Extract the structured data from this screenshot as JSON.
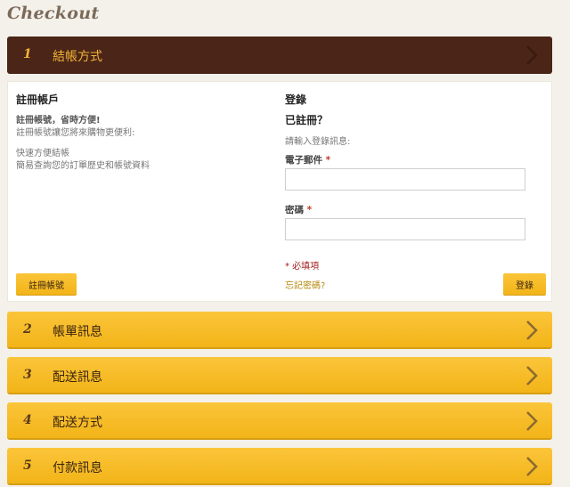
{
  "page": {
    "title": "Checkout"
  },
  "steps": [
    {
      "num": "1",
      "label": "結帳方式"
    },
    {
      "num": "2",
      "label": "帳單訊息"
    },
    {
      "num": "3",
      "label": "配送訊息"
    },
    {
      "num": "4",
      "label": "配送方式"
    },
    {
      "num": "5",
      "label": "付款訊息"
    }
  ],
  "register": {
    "heading": "註冊帳戶",
    "tagline": "註冊帳號，省時方便!",
    "desc": "註冊帳號讓您將來購物更便利:",
    "benefits": [
      "快速方便結帳",
      "簡易查詢您的訂單歷史和帳號資料"
    ],
    "button": "註冊帳號"
  },
  "login": {
    "heading": "登錄",
    "subheading": "已註冊？",
    "prompt": "請輸入登錄訊息:",
    "email_label": "電子郵件",
    "password_label": "密碼",
    "required_mark": "*",
    "required_note": "* 必填項",
    "forgot": "忘記密碼?",
    "button": "登錄"
  },
  "colors": {
    "active_step_bg": "#4b2517",
    "active_step_text": "#f0b43a",
    "step_bg": "#f7bd27",
    "button_bg": "#f7bd27"
  }
}
